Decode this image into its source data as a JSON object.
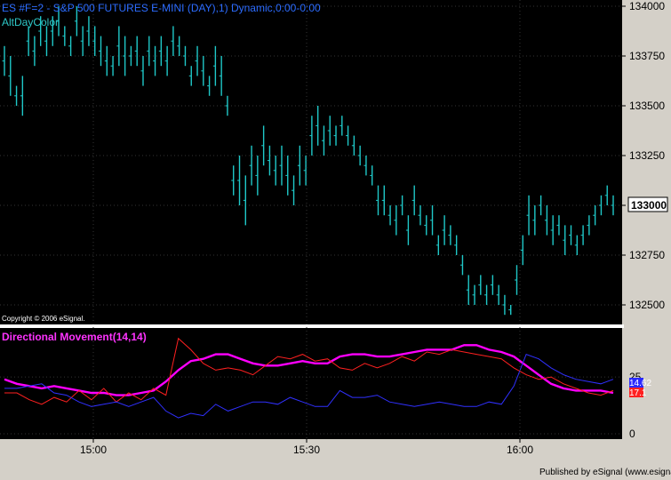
{
  "chart_data": [
    {
      "type": "bar",
      "subtype": "ohlc-price",
      "title": "ES #F=2 - S&P 500 FUTURES E-MINI (DAY),1) Dynamic,0:00-0:00",
      "subtitle": "AltDayColor",
      "copyright": "Copyright © 2006 eSignal.",
      "ylim": [
        132400,
        134000
      ],
      "y_ticks": [
        "134000",
        "133750",
        "133500",
        "133250",
        "133000",
        "132750",
        "132500"
      ],
      "last_price_label": "133000",
      "colors": {
        "bars": "#1fc8c8",
        "background": "#000000"
      },
      "bars": [
        [
          133800,
          133650
        ],
        [
          133750,
          133550
        ],
        [
          133600,
          133500
        ],
        [
          133650,
          133450
        ],
        [
          133900,
          133750
        ],
        [
          133850,
          133700
        ],
        [
          133950,
          133800
        ],
        [
          133900,
          133750
        ],
        [
          133950,
          133800
        ],
        [
          134000,
          133850
        ],
        [
          133900,
          133800
        ],
        [
          133850,
          133750
        ],
        [
          134000,
          133850
        ],
        [
          133900,
          133750
        ],
        [
          133950,
          133800
        ],
        [
          133900,
          133750
        ],
        [
          133850,
          133700
        ],
        [
          133800,
          133650
        ],
        [
          133750,
          133650
        ],
        [
          133900,
          133700
        ],
        [
          133850,
          133650
        ],
        [
          133800,
          133700
        ],
        [
          133850,
          133700
        ],
        [
          133750,
          133600
        ],
        [
          133850,
          133700
        ],
        [
          133800,
          133650
        ],
        [
          133850,
          133700
        ],
        [
          133800,
          133650
        ],
        [
          133900,
          133750
        ],
        [
          133850,
          133750
        ],
        [
          133800,
          133700
        ],
        [
          133700,
          133600
        ],
        [
          133800,
          133650
        ],
        [
          133750,
          133600
        ],
        [
          133650,
          133550
        ],
        [
          133800,
          133600
        ],
        [
          133750,
          133550
        ],
        [
          133550,
          133450
        ],
        [
          133200,
          133050
        ],
        [
          133250,
          133000
        ],
        [
          133150,
          132900
        ],
        [
          133300,
          133100
        ],
        [
          133250,
          133050
        ],
        [
          133400,
          133200
        ],
        [
          133300,
          133150
        ],
        [
          133250,
          133100
        ],
        [
          133300,
          133100
        ],
        [
          133250,
          133050
        ],
        [
          133150,
          133000
        ],
        [
          133300,
          133100
        ],
        [
          133250,
          133100
        ],
        [
          133450,
          133250
        ],
        [
          133500,
          133300
        ],
        [
          133400,
          133250
        ],
        [
          133450,
          133300
        ],
        [
          133400,
          133300
        ],
        [
          133450,
          133350
        ],
        [
          133400,
          133300
        ],
        [
          133350,
          133250
        ],
        [
          133300,
          133200
        ],
        [
          133250,
          133150
        ],
        [
          133200,
          133100
        ],
        [
          133100,
          132950
        ],
        [
          133100,
          132950
        ],
        [
          133000,
          132900
        ],
        [
          133000,
          132850
        ],
        [
          133050,
          132950
        ],
        [
          132950,
          132800
        ],
        [
          133100,
          132950
        ],
        [
          133000,
          132900
        ],
        [
          132950,
          132850
        ],
        [
          133000,
          132850
        ],
        [
          132850,
          132750
        ],
        [
          132950,
          132800
        ],
        [
          132900,
          132800
        ],
        [
          132850,
          132750
        ],
        [
          132750,
          132650
        ],
        [
          132650,
          132500
        ],
        [
          132600,
          132500
        ],
        [
          132650,
          132550
        ],
        [
          132600,
          132500
        ],
        [
          132650,
          132550
        ],
        [
          132600,
          132500
        ],
        [
          132550,
          132450
        ],
        [
          132500,
          132450
        ],
        [
          132700,
          132550
        ],
        [
          132850,
          132700
        ],
        [
          133050,
          132850
        ],
        [
          133000,
          132850
        ],
        [
          133050,
          132950
        ],
        [
          133000,
          132850
        ],
        [
          132950,
          132800
        ],
        [
          132950,
          132850
        ],
        [
          132900,
          132750
        ],
        [
          132900,
          132800
        ],
        [
          132850,
          132750
        ],
        [
          132900,
          132800
        ],
        [
          132950,
          132850
        ],
        [
          133000,
          132900
        ],
        [
          133050,
          132950
        ],
        [
          133100,
          133000
        ],
        [
          133050,
          132950
        ]
      ]
    },
    {
      "type": "line",
      "title": "Directional Movement(14,14)",
      "ylim": [
        0,
        45
      ],
      "y_ticks": [
        "25",
        "0"
      ],
      "value_labels": [
        "14.62",
        "17.1"
      ],
      "x_ticks": [
        "15:00",
        "15:30",
        "16:00"
      ],
      "series": [
        {
          "color": "#ff00ff",
          "values": [
            24,
            22,
            21,
            20,
            21,
            20,
            19,
            18,
            18,
            17,
            17,
            18,
            19,
            23,
            28,
            32,
            33,
            35,
            35,
            33,
            31,
            30,
            30,
            31,
            32,
            31,
            31,
            34,
            35,
            35,
            34,
            34,
            35,
            36,
            37,
            37,
            37,
            39,
            39,
            37,
            36,
            34,
            30,
            26,
            22,
            20,
            19,
            19,
            19,
            18
          ]
        },
        {
          "color": "#ff2020",
          "values": [
            18,
            18,
            15,
            13,
            16,
            14,
            19,
            15,
            20,
            14,
            18,
            15,
            20,
            17,
            42,
            37,
            31,
            28,
            29,
            28,
            26,
            30,
            34,
            33,
            35,
            32,
            33,
            29,
            28,
            31,
            29,
            31,
            34,
            32,
            36,
            35,
            37,
            36,
            35,
            34,
            33,
            29,
            26,
            24,
            25,
            22,
            20,
            18,
            17,
            19
          ]
        },
        {
          "color": "#3030ff",
          "values": [
            20,
            20,
            21,
            22,
            18,
            17,
            14,
            12,
            13,
            14,
            12,
            14,
            16,
            10,
            7,
            9,
            8,
            13,
            10,
            12,
            14,
            14,
            13,
            16,
            14,
            12,
            12,
            19,
            16,
            16,
            17,
            14,
            13,
            12,
            13,
            14,
            13,
            12,
            12,
            14,
            13,
            21,
            35,
            33,
            29,
            26,
            24,
            23,
            22,
            24
          ]
        }
      ]
    }
  ],
  "footer": {
    "publisher": "Published by eSignal (www.esignal.com)"
  }
}
